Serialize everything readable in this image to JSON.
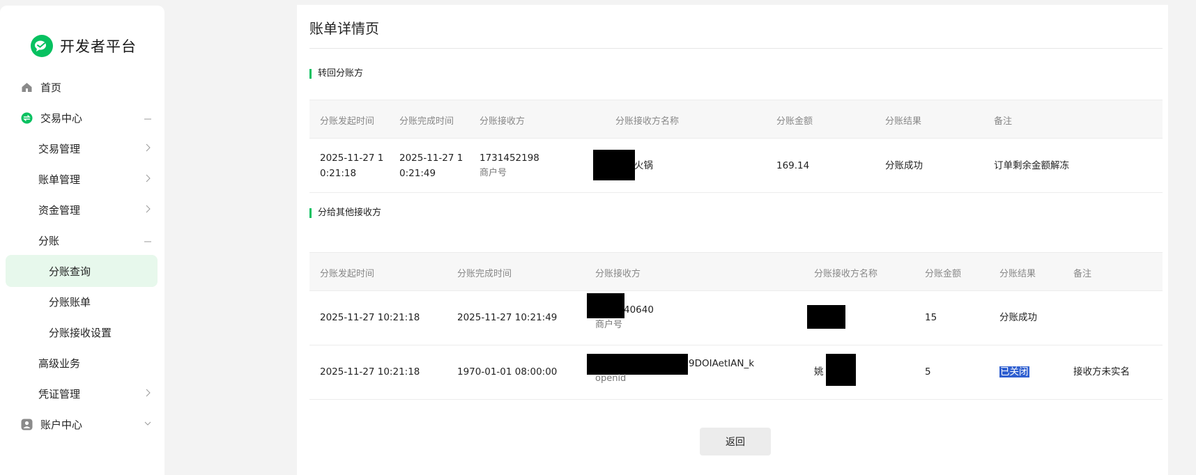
{
  "brand": {
    "title": "开发者平台"
  },
  "nav": {
    "home": "首页",
    "trade_center": "交易中心",
    "trade_manage": "交易管理",
    "bill_manage": "账单管理",
    "fund_manage": "资金管理",
    "profit_share": "分账",
    "profit_share_query": "分账查询",
    "profit_share_bill": "分账账单",
    "profit_share_receiver_settings": "分账接收设置",
    "advanced_business": "高级业务",
    "credential_manage": "凭证管理",
    "account_center": "账户中心"
  },
  "page": {
    "title": "账单详情页"
  },
  "section1": {
    "title": "转回分账方",
    "headers": [
      "分账发起时间",
      "分账完成时间",
      "分账接收方",
      "分账接收方名称",
      "分账金额",
      "分账结果",
      "备注"
    ],
    "rows": [
      {
        "start_time_l1": "2025-11-27 1",
        "start_time_l2": "0:21:18",
        "end_time_l1": "2025-11-27 1",
        "end_time_l2": "0:21:49",
        "receiver": "1731452198",
        "receiver_type": "商户号",
        "receiver_name": "火锅",
        "amount": "169.14",
        "result": "分账成功",
        "remark": "订单剩余金额解冻"
      }
    ]
  },
  "section2": {
    "title": "分给其他接收方",
    "headers": [
      "分账发起时间",
      "分账完成时间",
      "分账接收方",
      "分账接收方名称",
      "分账金额",
      "分账结果",
      "备注"
    ],
    "rows": [
      {
        "start_time": "2025-11-27 10:21:18",
        "end_time": "2025-11-27 10:21:49",
        "receiver": "40640",
        "receiver_type": "商户号",
        "receiver_name": "",
        "amount": "15",
        "result": "分账成功",
        "remark": ""
      },
      {
        "start_time": "2025-11-27 10:21:18",
        "end_time": "1970-01-01 08:00:00",
        "receiver": "9DOIAetIAN_k",
        "receiver_type": "openid",
        "receiver_name": "姚",
        "amount": "5",
        "result": "已关闭",
        "remark": "接收方未实名"
      }
    ]
  },
  "actions": {
    "back_label": "返回"
  },
  "colors": {
    "accent": "#07c160",
    "active_bg": "#e7f8ec",
    "highlight": "#2f5fd0"
  }
}
